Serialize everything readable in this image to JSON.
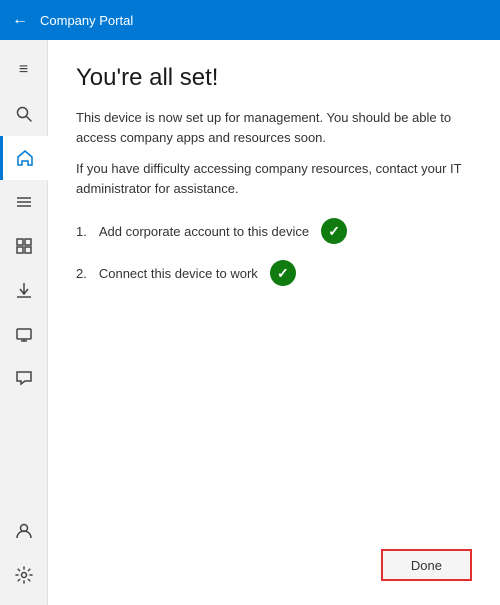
{
  "titleBar": {
    "title": "Company Portal",
    "backLabel": "←"
  },
  "sidebar": {
    "items": [
      {
        "id": "menu",
        "icon": "≡",
        "active": false
      },
      {
        "id": "search",
        "icon": "🔍",
        "active": false
      },
      {
        "id": "home",
        "icon": "⌂",
        "active": true
      },
      {
        "id": "list",
        "icon": "☰",
        "active": false
      },
      {
        "id": "grid",
        "icon": "⊞",
        "active": false
      },
      {
        "id": "download",
        "icon": "↓",
        "active": false
      },
      {
        "id": "device",
        "icon": "▭",
        "active": false
      },
      {
        "id": "chat",
        "icon": "💬",
        "active": false
      }
    ],
    "bottomItems": [
      {
        "id": "user",
        "icon": "👤"
      },
      {
        "id": "settings",
        "icon": "⚙"
      }
    ]
  },
  "content": {
    "title": "You're all set!",
    "description1": "This device is now set up for management.  You should be able to access company apps and resources soon.",
    "description2": "If you have difficulty accessing company resources, contact your IT administrator for assistance.",
    "steps": [
      {
        "number": "1",
        "text": "Add corporate account to this device",
        "completed": true
      },
      {
        "number": "2",
        "text": "Connect this device to work",
        "completed": true
      }
    ],
    "doneButton": "Done"
  }
}
